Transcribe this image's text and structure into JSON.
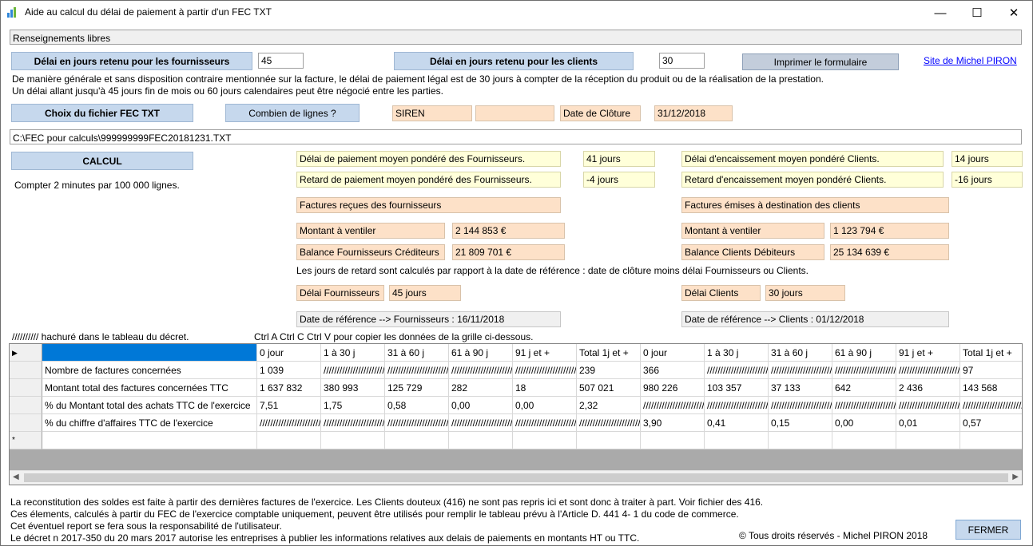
{
  "window": {
    "title": "Aide au calcul du délai de paiement à partir d'un FEC TXT"
  },
  "top": {
    "free_info": "Renseignements libres",
    "supplier_delay_label": "Délai en jours retenu pour les fournisseurs",
    "supplier_delay_value": "45",
    "client_delay_label": "Délai en jours retenu pour les clients",
    "client_delay_value": "30",
    "print_label": "Imprimer le formulaire",
    "site_link": "Site de Michel PIRON",
    "info_line1": "De manière générale et sans disposition contraire mentionnée sur la facture, le délai de paiement légal est de 30 jours à compter de la réception du produit ou de la réalisation de la prestation.",
    "info_line2": "Un délai allant jusqu'à 45 jours fin de mois ou 60 jours calendaires peut être négocié entre les parties.",
    "choose_file_label": "Choix du fichier FEC TXT",
    "count_lines_label": "Combien de lignes ?",
    "siren_label": "SIREN",
    "siren_value": "",
    "closing_label": "Date de Clôture",
    "closing_value": "31/12/2018",
    "file_path": "C:\\FEC pour calculs\\999999999FEC20181231.TXT",
    "calc_label": "CALCUL",
    "calc_note": "Compter 2 minutes par 100 000 lignes."
  },
  "suppliers": {
    "avg_delay_label": "Délai de paiement moyen pondéré des Fournisseurs.",
    "avg_delay_value": "41 jours",
    "late_label": "Retard de paiement moyen pondéré des Fournisseurs.",
    "late_value": "-4 jours",
    "section_label": "Factures reçues des fournisseurs",
    "amount_label": "Montant à ventiler",
    "amount_value": "2 144 853 €",
    "balance_label": "Balance Fournisseurs Créditeurs",
    "balance_value": "21 809 701 €",
    "delay_label": "Délai Fournisseurs",
    "delay_value": "45 jours",
    "ref_date": "Date de référence --> Fournisseurs :   16/11/2018"
  },
  "clients": {
    "avg_delay_label": "Délai d'encaissement moyen pondéré Clients.",
    "avg_delay_value": "14 jours",
    "late_label": "Retard d'encaissement moyen pondéré Clients.",
    "late_value": "-16 jours",
    "section_label": "Factures  émises à destination des clients",
    "amount_label": "Montant à ventiler",
    "amount_value": "1 123 794 €",
    "balance_label": "Balance Clients Débiteurs",
    "balance_value": "25 134 639 €",
    "delay_label": "Délai Clients",
    "delay_value": "30 jours",
    "ref_date": "Date de référence --> Clients :   01/12/2018"
  },
  "notes": {
    "late_explain": "Les jours de retard sont calculés par rapport à la date de référence : date de clôture  moins délai  Fournisseurs ou Clients.",
    "hatch": "//////////  hachuré dans le tableau du décret.",
    "copy": "Ctrl A  Ctrl C  Ctrl  V pour copier  les données de la grille  ci-dessous."
  },
  "grid": {
    "headers": [
      "",
      "0 jour",
      "1 à 30 j",
      "31 à 60 j",
      "61 à 90 j",
      "91 j et +",
      "Total 1j et +",
      "0 jour",
      "1 à 30 j",
      "31 à 60 j",
      "61 à 90 j",
      "91 j et +",
      "Total 1j et +"
    ],
    "rows": [
      [
        "Nombre de factures concernées",
        "  1 039",
        "///////////////////////////////",
        "///////////////////////////////",
        "///////////////////////////////",
        "///////////////////////////////",
        "  239",
        "  366",
        "///////////////////////////////",
        "///////////////////////////////",
        "///////////////////////////////",
        "///////////////////////////////",
        "  97"
      ],
      [
        "Montant total des factures concernées TTC",
        " 1 637 832",
        "  380 993",
        "  125 729",
        "  282",
        "  18",
        " 507 021",
        " 980 226",
        "  103 357",
        "  37 133",
        "  642",
        "  2 436",
        " 143 568"
      ],
      [
        "% du Montant total des achats TTC de l'exercice",
        "7,51",
        "1,75",
        "0,58",
        "0,00",
        "0,00",
        "2,32",
        "///////////////////////////////",
        "///////////////////////////////",
        "///////////////////////////////",
        "///////////////////////////////",
        "///////////////////////////////",
        "///////////////////////////////"
      ],
      [
        "% du chiffre d'affaires TTC de l'exercice",
        "///////////////////////////////",
        "///////////////////////////////",
        "///////////////////////////////",
        "///////////////////////////////",
        "///////////////////////////////",
        "///////////////////////////////",
        "3,90",
        "0,41",
        "0,15",
        "0,00",
        "0,01",
        "0,57"
      ]
    ]
  },
  "footer": {
    "line1": "La reconstitution des soldes est faite à partir des dernières factures de l'exercice. Les Clients douteux (416) ne sont pas repris ici et sont donc à traiter à part. Voir fichier des 416.",
    "line2": "Ces élements, calculés à partir du FEC de l'exercice comptable uniquement, peuvent être utilisés pour remplir le tableau prévu à l'Article D. 441 4- 1  du code de commerce.",
    "line3": "Cet éventuel report se fera sous la responsabilité de l'utilisateur.",
    "line4": "Le décret n 2017-350 du 20 mars 2017 autorise les entreprises à publier les informations relatives aux delais de paiements en montants HT ou TTC.",
    "copyright": "© Tous droits réservés - Michel PIRON 2018",
    "close_label": "FERMER"
  }
}
